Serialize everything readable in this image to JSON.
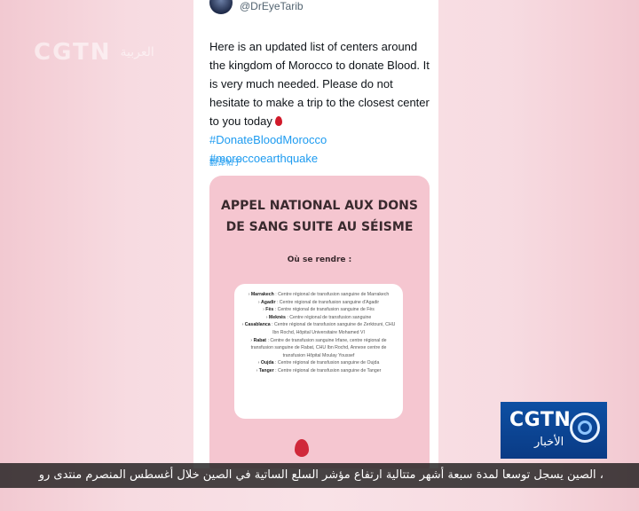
{
  "watermark": {
    "brand": "CGTN",
    "arabic": "العربية"
  },
  "tweet": {
    "handle": "@DrEyeTarib",
    "text": "Here is an updated list of centers around the kingdom of Morocco to donate Blood. It is very much needed. Please do not hesitate to make a trip to the closest center to you today",
    "hashtags": "#DonateBloodMorocco #moroccoearthquake",
    "translate": "翻译帖子",
    "card": {
      "title_line1": "APPEL NATIONAL AUX DONS",
      "title_line2": "DE SANG SUITE AU SÉISME",
      "subtitle": "Où se rendre :",
      "items": [
        {
          "city": "Marrakech",
          "detail": " : Centre régional de transfusion sanguine de Marrakech"
        },
        {
          "city": "Agadir",
          "detail": " : Centre régional de transfusion sanguine d'Agadir"
        },
        {
          "city": "Fès",
          "detail": " : Centre régional de transfusion sanguine de Fès"
        },
        {
          "city": "Meknès",
          "detail": " : Centre régional de transfusion sanguine"
        },
        {
          "city": "Casablanca",
          "detail": " : Centre régional de transfusion sanguine de Zerktouni, CHU Ibn Rochd, Hôpital Universitaire Mohamed VI"
        },
        {
          "city": "Rabat",
          "detail": " : Centre de transfusion sanguine Irfane, centre régional de transfusion sanguine de Rabat, CHU Ibn Rochd, Annexe centre de transfusion Hôpital Moulay Youssef"
        },
        {
          "city": "Oujda",
          "detail": " : Centre régional de transfusion sanguine de Oujda"
        },
        {
          "city": "Tanger",
          "detail": " : Centre régional de transfusion sanguine de Tanger"
        }
      ]
    }
  },
  "logo": {
    "brand": "CGTN",
    "arabic": "الأخبار"
  },
  "ticker": {
    "text": "، الصين يسجل توسعا لمدة سبعة أشهر متتالية  ارتفاع مؤشر السلع الساتية في الصين خلال أغسطس المنصرم  منتدى رو"
  }
}
